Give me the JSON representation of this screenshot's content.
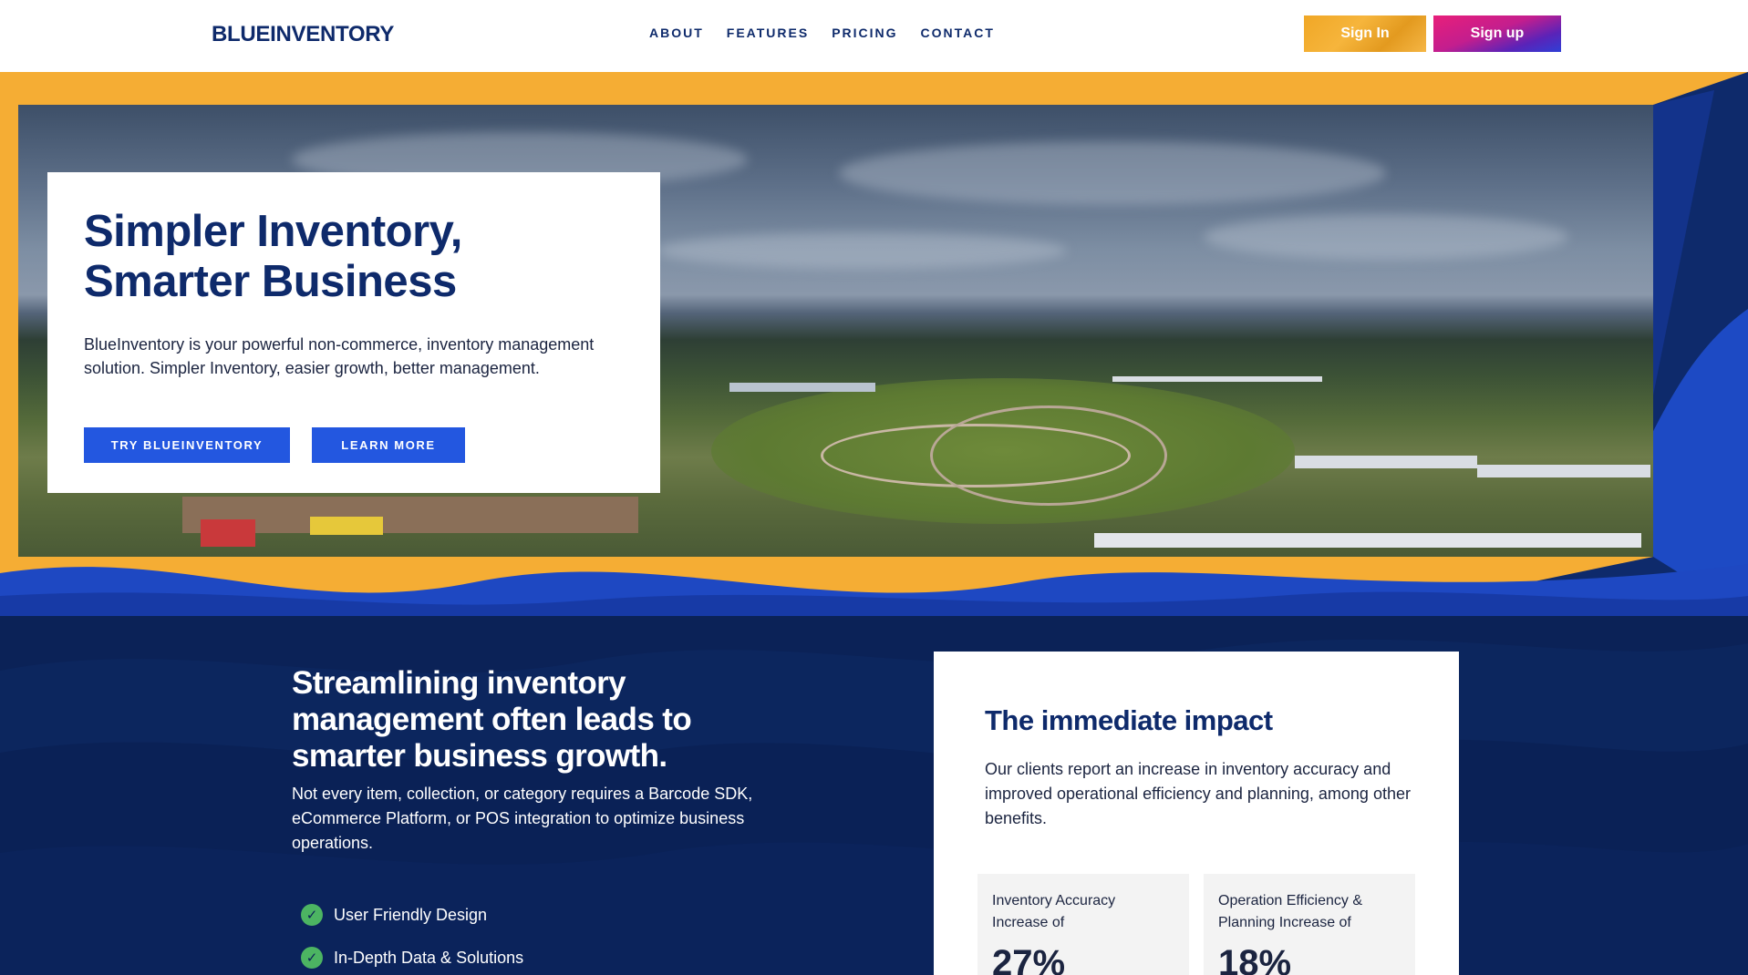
{
  "header": {
    "logo": "BLUEINVENTORY",
    "nav": [
      "ABOUT",
      "FEATURES",
      "PRICING",
      "CONTACT"
    ],
    "sign_in": "Sign In",
    "sign_up": "Sign up"
  },
  "hero": {
    "title": "Simpler Inventory, Smarter Business",
    "description": "BlueInventory is your powerful non-commerce, inventory management solution. Simpler Inventory, easier growth, better management.",
    "primary_button": "TRY BLUEINVENTORY",
    "secondary_button": "LEARN MORE"
  },
  "section": {
    "title": "Streamlining inventory management often leads to smarter business growth.",
    "description": "Not every item, collection, or category requires a Barcode SDK, eCommerce Platform, or POS integration to optimize business operations.",
    "features": [
      "User Friendly Design",
      "In-Depth Data & Solutions"
    ]
  },
  "impact": {
    "title": "The immediate impact",
    "description": "Our clients report an increase in inventory accuracy and improved operational efficiency and planning, among other benefits.",
    "stats": [
      {
        "label": "Inventory Accuracy Increase of",
        "value": "27%"
      },
      {
        "label": "Operation Efficiency & Planning Increase of",
        "value": "18%"
      }
    ]
  },
  "colors": {
    "navy": "#0e2a6b",
    "accent_blue": "#2357e0",
    "orange": "#f5ad34",
    "check_green": "#4cb462"
  }
}
